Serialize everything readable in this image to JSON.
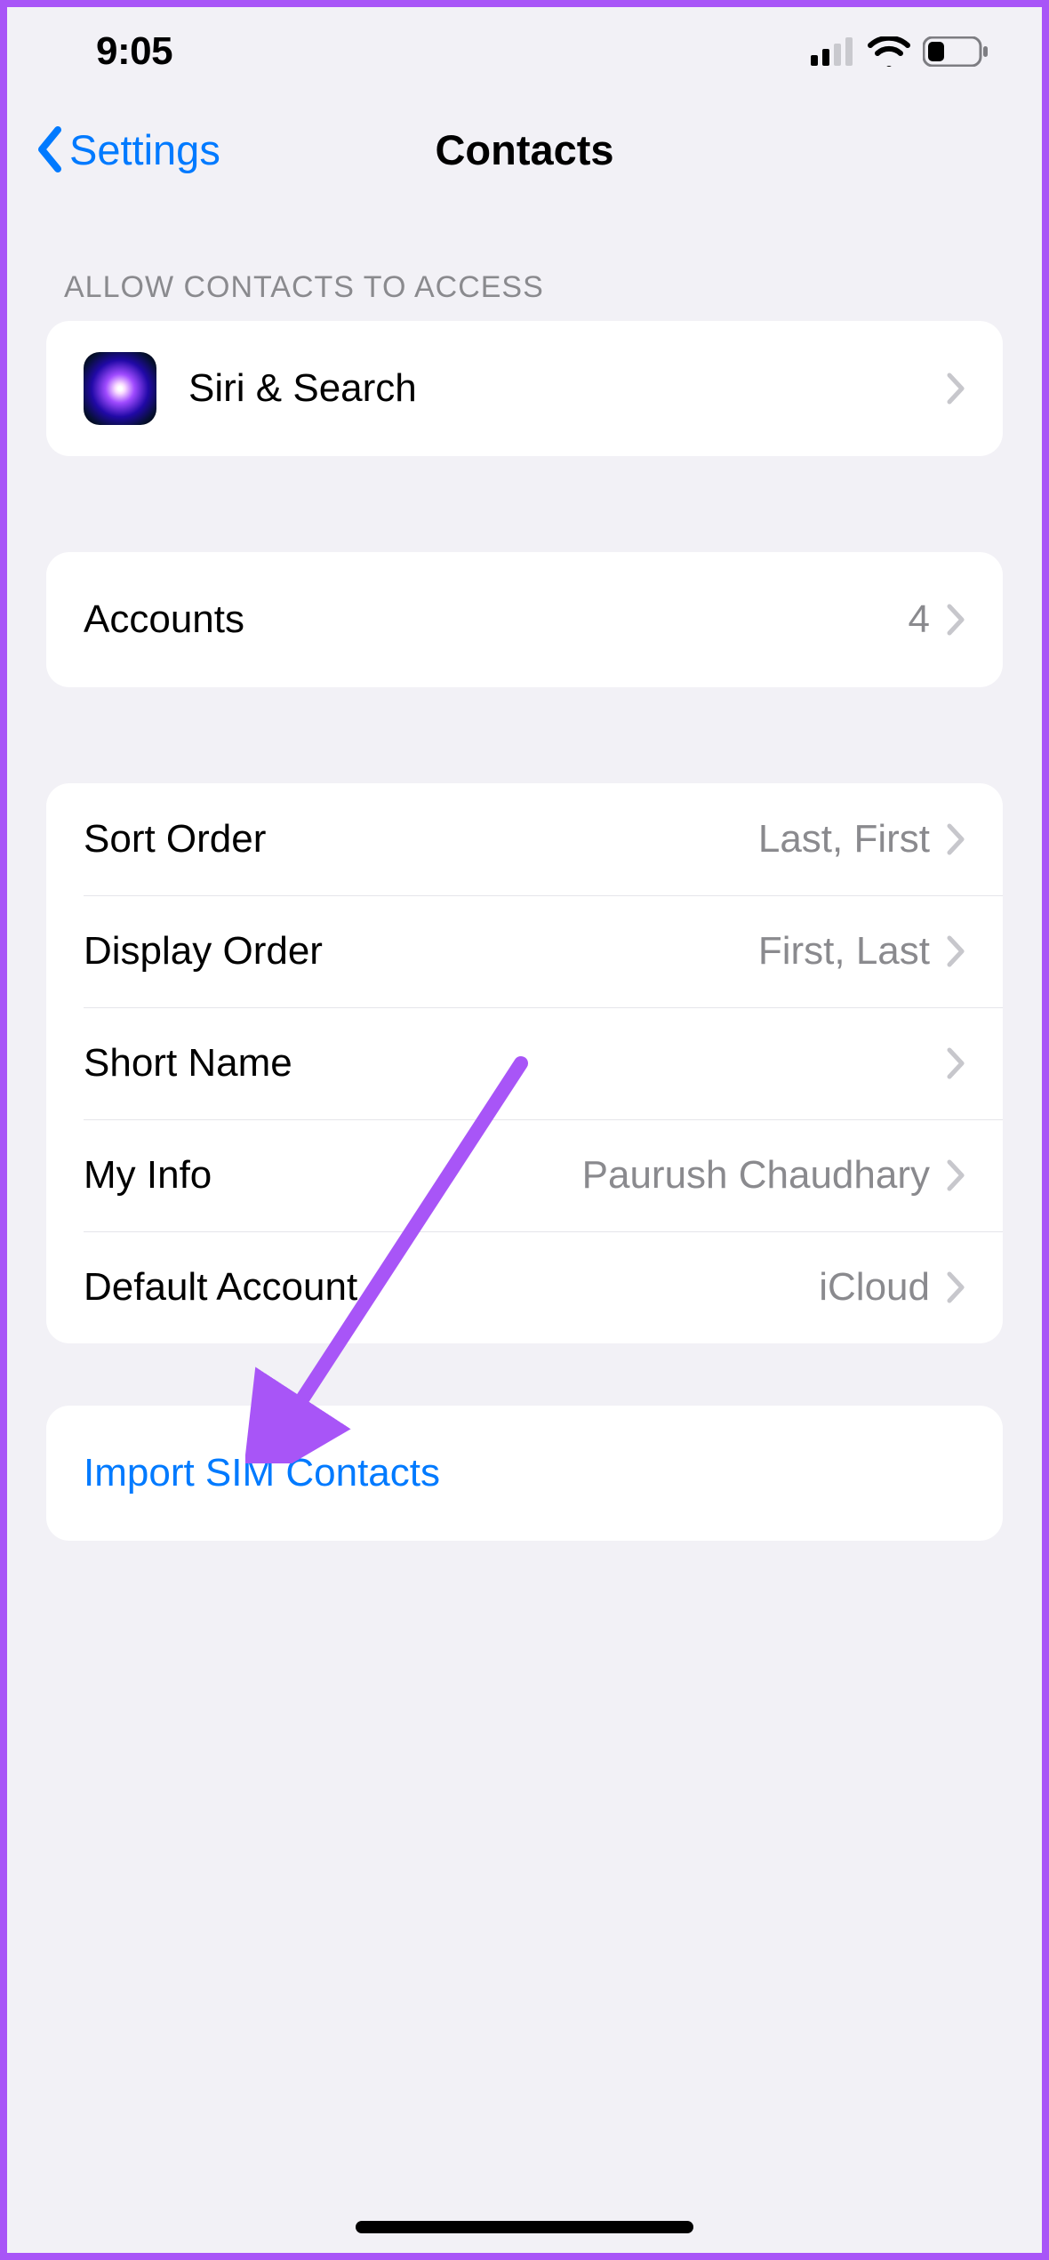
{
  "status": {
    "time": "9:05"
  },
  "nav": {
    "back_label": "Settings",
    "title": "Contacts"
  },
  "access_header": "ALLOW CONTACTS TO ACCESS",
  "siri": {
    "label": "Siri & Search"
  },
  "accounts": {
    "label": "Accounts",
    "value": "4"
  },
  "settings": {
    "sort_order": {
      "label": "Sort Order",
      "value": "Last, First"
    },
    "display_order": {
      "label": "Display Order",
      "value": "First, Last"
    },
    "short_name": {
      "label": "Short Name"
    },
    "my_info": {
      "label": "My Info",
      "value": "Paurush  Chaudhary"
    },
    "default_acct": {
      "label": "Default Account",
      "value": "iCloud"
    }
  },
  "import_sim": {
    "label": "Import SIM Contacts"
  }
}
